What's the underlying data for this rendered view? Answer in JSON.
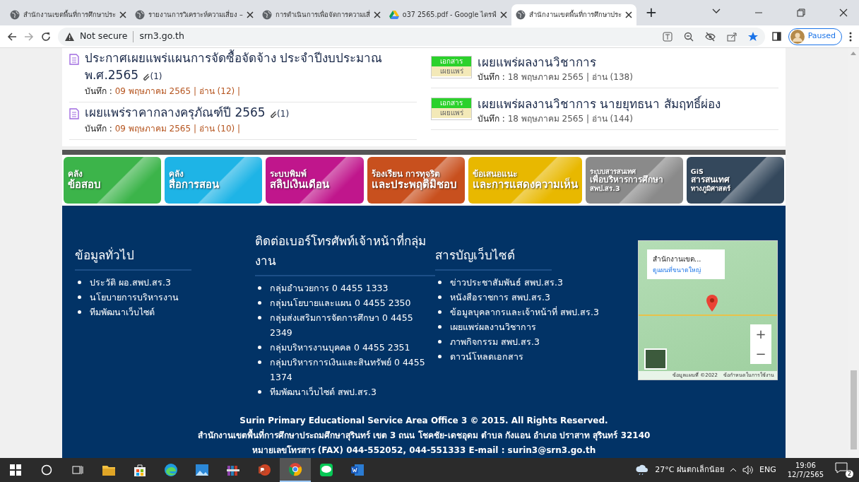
{
  "browser": {
    "tabs": [
      {
        "title": "สำนักงานเขตพื้นที่การศึกษาประ",
        "kind": "globe",
        "selected": false
      },
      {
        "title": "รายงานการวิเคราะห์ความเสี่ยง –",
        "kind": "globe",
        "selected": false
      },
      {
        "title": "การดำเนินการเพื่อจัดการความเสี่",
        "kind": "globe",
        "selected": false
      },
      {
        "title": "o37 2565.pdf - Google ไดรฟ์",
        "kind": "drive",
        "selected": false
      },
      {
        "title": "สำนักงานเขตพื้นที่การศึกษาประ",
        "kind": "globe",
        "selected": true
      }
    ],
    "new_tab": "+",
    "security": "Not secure",
    "url": "srn3.go.th",
    "profile": "Paused"
  },
  "news": {
    "left": [
      {
        "kind": "doc",
        "title": "ประกาศเผยแพร่แผนการจัดซื้อจัดจ้าง ประจำปีงบประมาณ พ.ศ.2565",
        "attachments": "(1)",
        "label": "บันทึก :",
        "meta": "09 พฤษภาคม 2565 | อ่าน (12) |"
      },
      {
        "kind": "doc",
        "title": "เผยแพร่ราคากลางครุภัณฑ์ปี 2565",
        "attachments": "(1)",
        "label": "บันทึก :",
        "meta": "09 พฤษภาคม 2565 | อ่าน (10) |"
      }
    ],
    "right": [
      {
        "kind": "badge",
        "badge": [
          "เอกสาร",
          "เผยแพร่"
        ],
        "title": "เผยแพร่ผลงานวิชาการ",
        "label": "บันทึก :",
        "meta": "18 พฤษภาคม 2565 | อ่าน (138)"
      },
      {
        "kind": "badge",
        "badge": [
          "เอกสาร",
          "เผยแพร่"
        ],
        "title": "เผยแพร่ผลงานวิชาการ นายยุทธนา สัมฤทธิ์ผ่อง",
        "label": "บันทึก :",
        "meta": "18 พฤษภาคม 2565 | อ่าน (144)"
      }
    ]
  },
  "banners": [
    {
      "lines": [
        "คลัง",
        "ข้อสอบ"
      ],
      "color": "#3cb44a"
    },
    {
      "lines": [
        "คลัง",
        "สื่อการสอน"
      ],
      "color": "#1eb4e6"
    },
    {
      "lines": [
        "ระบบพิมพ์",
        "สลิปเงินเดือน"
      ],
      "color": "#c0168c"
    },
    {
      "lines": [
        "ร้องเรียน การทุจริต",
        "และประพฤติมิชอบ"
      ],
      "color": "#c8501e"
    },
    {
      "lines": [
        "ข้อเสนอแนะ",
        "และการแสดงความเห็น"
      ],
      "color": "#e8b800"
    },
    {
      "lines": [
        "ระบบสารสนเทศ",
        "เพื่อบริหารการศึกษา",
        "สพป.สร.3"
      ],
      "color": "#8a8a8a"
    },
    {
      "lines": [
        "GiS",
        "สารสนเทศ",
        "ทางภูมิศาสตร์"
      ],
      "color": "#34485c"
    }
  ],
  "footer": {
    "columns": [
      {
        "heading": "ข้อมูลทั่วไป",
        "items": [
          "ประวัติ ผอ.สพป.สร.3",
          "นโยบายการบริหารงาน",
          "ทีมพัฒนาเว็บไซต์"
        ]
      },
      {
        "heading": "ติดต่อเบอร์โทรศัพท์เจ้าหน้าที่กลุ่มงาน",
        "items": [
          "กลุ่มอำนวยการ 0 4455 1333",
          "กลุ่มนโยบายและแผน 0 4455 2350",
          "กลุ่มส่งเสริมการจัดการศึกษา 0 4455 2349",
          "กลุ่มบริหารงานบุคคล 0 4455 2351",
          "กลุ่มบริหารการเงินและสินทรัพย์ 0 4455 1374",
          "ทีมพัฒนาเว็บไซต์ สพป.สร.3"
        ]
      },
      {
        "heading": "สารบัญเว็บไซต์",
        "items": [
          "ข่าวประชาสัมพันธ์ สพป.สร.3",
          "หนังสือราชการ สพป.สร.3",
          "ข้อมูลบุคลากรและเจ้าหน้าที่ สพป.สร.3",
          "เผยแพร่ผลงานวิชาการ",
          "ภาพกิจกรรม สพป.สร.3",
          "ดาวน์โหลดเอกสาร"
        ]
      }
    ],
    "map": {
      "card_title": "สำนักงานเขต...",
      "card_link": "ดูแผนที่ขนาดใหญ่",
      "zoom_in": "+",
      "zoom_out": "−",
      "attribution": "ข้อมูลแผนที่ ©2022",
      "terms": "ข้อกำหนดในการใช้งาน"
    },
    "lines": [
      "Surin Primary Educational Service Area Office 3 © 2015. All Rights Reserved.",
      "สำนักงานเขตพื้นที่การศึกษาประถมศึกษาสุรินทร์ เขต 3 ถนน โชคชัย-เดชอุดม ตำบล กังแอน อำเภอ ปราสาท สุรินทร์ 32140",
      "หมายเลขโทรสาร (FAX) 044-552052, 044-551333 E-mail : surin3@srn3.go.th"
    ]
  },
  "taskbar": {
    "apps": [
      {
        "kind": "folder",
        "selected": false
      },
      {
        "kind": "store",
        "selected": false
      },
      {
        "kind": "edge",
        "selected": false
      },
      {
        "kind": "photos",
        "selected": false
      },
      {
        "kind": "archive",
        "selected": false
      },
      {
        "kind": "powerpoint",
        "selected": false
      },
      {
        "kind": "chrome",
        "selected": true
      },
      {
        "kind": "line",
        "selected": false
      },
      {
        "kind": "word",
        "selected": false
      }
    ],
    "weather": "27°C ฝนตกเล็กน้อย",
    "language": "ENG",
    "time": "19:06",
    "date": "12/7/2565",
    "notifications": "2"
  }
}
